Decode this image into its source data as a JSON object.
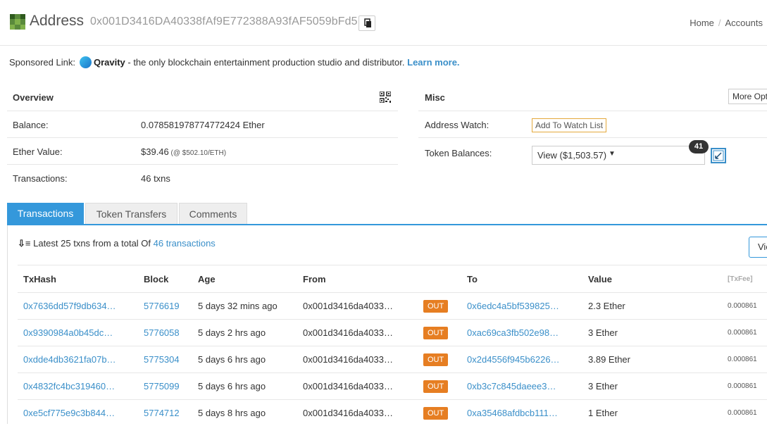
{
  "header": {
    "title": "Address",
    "address": "0x001D3416DA40338fAf9E772388A93fAF5059bFd5",
    "breadcrumb": [
      "Home",
      "Accounts"
    ]
  },
  "sponsor": {
    "prefix": "Sponsored Link:",
    "brand": "Qravity",
    "text": " - the only blockchain entertainment production studio and distributor. ",
    "link": "Learn more."
  },
  "overview": {
    "title": "Overview",
    "rows": [
      {
        "label": "Balance:",
        "value": "0.078581978774772424 Ether",
        "extra": ""
      },
      {
        "label": "Ether Value:",
        "value": "$39.46",
        "extra": " (@ $502.10/ETH)"
      },
      {
        "label": "Transactions:",
        "value": "46 txns",
        "extra": ""
      }
    ]
  },
  "misc": {
    "title": "Misc",
    "more_options": "More Options",
    "address_watch_label": "Address Watch:",
    "watch_button": "Add To Watch List",
    "token_label": "Token Balances:",
    "token_value": "View ($1,503.57)",
    "token_count": "41"
  },
  "tabs": [
    {
      "label": "Transactions",
      "active": true
    },
    {
      "label": "Token Transfers",
      "active": false
    },
    {
      "label": "Comments",
      "active": false
    }
  ],
  "txlist": {
    "summary_prefix": "Latest 25 txns from a total Of ",
    "summary_link": "46 transactions",
    "view_button": "View",
    "columns": [
      "TxHash",
      "Block",
      "Age",
      "From",
      "",
      "To",
      "Value",
      "[TxFee]"
    ],
    "rows": [
      {
        "hash": "0x7636dd57f9db634…",
        "block": "5776619",
        "age": "5 days 32 mins ago",
        "from": "0x001d3416da4033…",
        "dir": "OUT",
        "to": "0x6edc4a5bf539825…",
        "value": "2.3 Ether",
        "fee": "0.000861"
      },
      {
        "hash": "0x9390984a0b45dc…",
        "block": "5776058",
        "age": "5 days 2 hrs ago",
        "from": "0x001d3416da4033…",
        "dir": "OUT",
        "to": "0xac69ca3fb502e98…",
        "value": "3 Ether",
        "fee": "0.000861"
      },
      {
        "hash": "0xdde4db3621fa07b…",
        "block": "5775304",
        "age": "5 days 6 hrs ago",
        "from": "0x001d3416da4033…",
        "dir": "OUT",
        "to": "0x2d4556f945b6226…",
        "value": "3.89 Ether",
        "fee": "0.000861"
      },
      {
        "hash": "0x4832fc4bc319460…",
        "block": "5775099",
        "age": "5 days 6 hrs ago",
        "from": "0x001d3416da4033…",
        "dir": "OUT",
        "to": "0xb3c7c845daeee3…",
        "value": "3 Ether",
        "fee": "0.000861"
      },
      {
        "hash": "0xe5cf775e9c3b844…",
        "block": "5774712",
        "age": "5 days 8 hrs ago",
        "from": "0x001d3416da4033…",
        "dir": "OUT",
        "to": "0xa35468afdbcb111…",
        "value": "1 Ether",
        "fee": "0.000861"
      }
    ]
  }
}
